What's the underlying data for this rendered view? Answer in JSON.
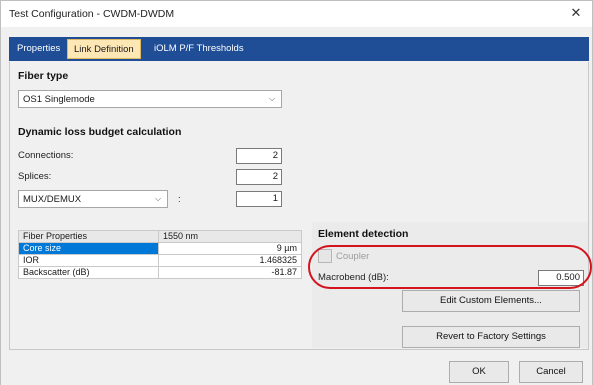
{
  "window": {
    "title": "Test Configuration - CWDM-DWDM"
  },
  "tabs": [
    {
      "label": "Properties"
    },
    {
      "label": "Link Definition"
    },
    {
      "label": "iOLM P/F Thresholds"
    }
  ],
  "fiber_type": {
    "title": "Fiber type",
    "selected": "OS1 Singlemode"
  },
  "loss_budget": {
    "title": "Dynamic loss budget calculation",
    "connections_label": "Connections:",
    "connections_value": "2",
    "splices_label": "Splices:",
    "splices_value": "2",
    "component_selected": "MUX/DEMUX",
    "colon": ":",
    "component_value": "1"
  },
  "fiber_properties": {
    "header": [
      "Fiber Properties",
      "1550 nm"
    ],
    "rows": [
      [
        "Core size",
        "9 µm"
      ],
      [
        "IOR",
        "1.468325"
      ],
      [
        "Backscatter (dB)",
        "-81.87"
      ]
    ]
  },
  "element_detection": {
    "title": "Element detection",
    "coupler_label": "Coupler",
    "macrobend_label": "Macrobend (dB):",
    "macrobend_value": "0.500"
  },
  "buttons": {
    "edit_custom": "Edit Custom Elements...",
    "revert": "Revert to Factory Settings",
    "ok": "OK",
    "cancel": "Cancel"
  },
  "icons": {
    "close": "close-icon",
    "dropdown": "chevron-down-icon"
  },
  "colors": {
    "tab_bar": "#1f4e96",
    "active_tab": "#fde7b5",
    "highlight": "#d4141d",
    "selection": "#0078d7"
  }
}
